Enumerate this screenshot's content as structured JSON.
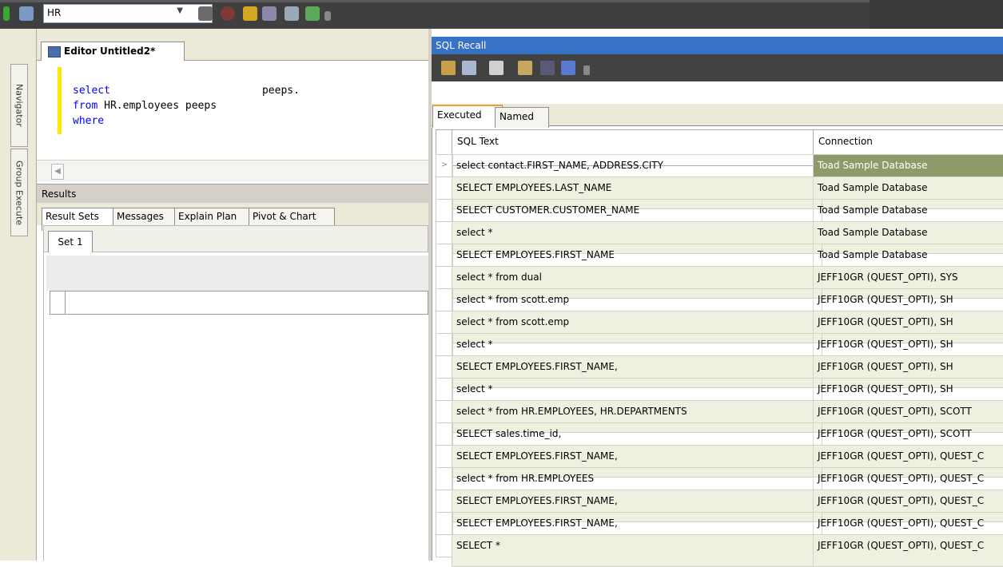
{
  "toolbar": {
    "schema": "HR"
  },
  "side_tabs": [
    "Navigator",
    "Group Execute"
  ],
  "editor": {
    "tab_label": "Editor Untitled2*",
    "lines": [
      {
        "kw": "select",
        "rest": "peeps."
      },
      {
        "kw": "from",
        "rest": " HR.employees peeps"
      },
      {
        "kw": "where",
        "rest": ""
      }
    ]
  },
  "results": {
    "header": "Results",
    "tabs": [
      "Result Sets",
      "Messages",
      "Explain Plan",
      "Pivot & Chart"
    ],
    "set_tab": "Set 1"
  },
  "recall": {
    "title": "SQL Recall",
    "tabs": [
      "Executed",
      "Named"
    ],
    "columns": [
      "SQL Text",
      "Connection"
    ],
    "rows": [
      {
        "sql": "select contact.FIRST_NAME, ADDRESS.CITY",
        "conn": "Toad Sample Database"
      },
      {
        "sql": "SELECT  EMPLOYEES.LAST_NAME",
        "conn": "Toad Sample Database"
      },
      {
        "sql": "SELECT  CUSTOMER.CUSTOMER_NAME",
        "conn": "Toad Sample Database"
      },
      {
        "sql": "select *",
        "conn": "Toad Sample Database"
      },
      {
        "sql": "SELECT  EMPLOYEES.FIRST_NAME",
        "conn": "Toad Sample Database"
      },
      {
        "sql": "select * from dual",
        "conn": "JEFF10GR (QUEST_OPTI), SYS"
      },
      {
        "sql": "select * from scott.emp",
        "conn": "JEFF10GR (QUEST_OPTI), SH"
      },
      {
        "sql": "select * from scott.emp",
        "conn": "JEFF10GR (QUEST_OPTI), SH"
      },
      {
        "sql": "select *",
        "conn": "JEFF10GR (QUEST_OPTI), SH"
      },
      {
        "sql": "SELECT EMPLOYEES.FIRST_NAME,",
        "conn": "JEFF10GR (QUEST_OPTI), SH"
      },
      {
        "sql": "select *",
        "conn": "JEFF10GR (QUEST_OPTI), SH"
      },
      {
        "sql": "select * from HR.EMPLOYEES, HR.DEPARTMENTS",
        "conn": "JEFF10GR (QUEST_OPTI), SCOTT"
      },
      {
        "sql": "SELECT sales.time_id,",
        "conn": "JEFF10GR (QUEST_OPTI), SCOTT"
      },
      {
        "sql": "SELECT EMPLOYEES.FIRST_NAME,",
        "conn": "JEFF10GR (QUEST_OPTI), QUEST_C"
      },
      {
        "sql": "select * from HR.EMPLOYEES",
        "conn": "JEFF10GR (QUEST_OPTI), QUEST_C"
      },
      {
        "sql": "SELECT EMPLOYEES.FIRST_NAME,",
        "conn": "JEFF10GR (QUEST_OPTI), QUEST_C"
      },
      {
        "sql": "SELECT EMPLOYEES.FIRST_NAME,",
        "conn": "JEFF10GR (QUEST_OPTI), QUEST_C"
      },
      {
        "sql": "SELECT *",
        "conn": "JEFF10GR (QUEST_OPTI), QUEST_C"
      }
    ]
  }
}
